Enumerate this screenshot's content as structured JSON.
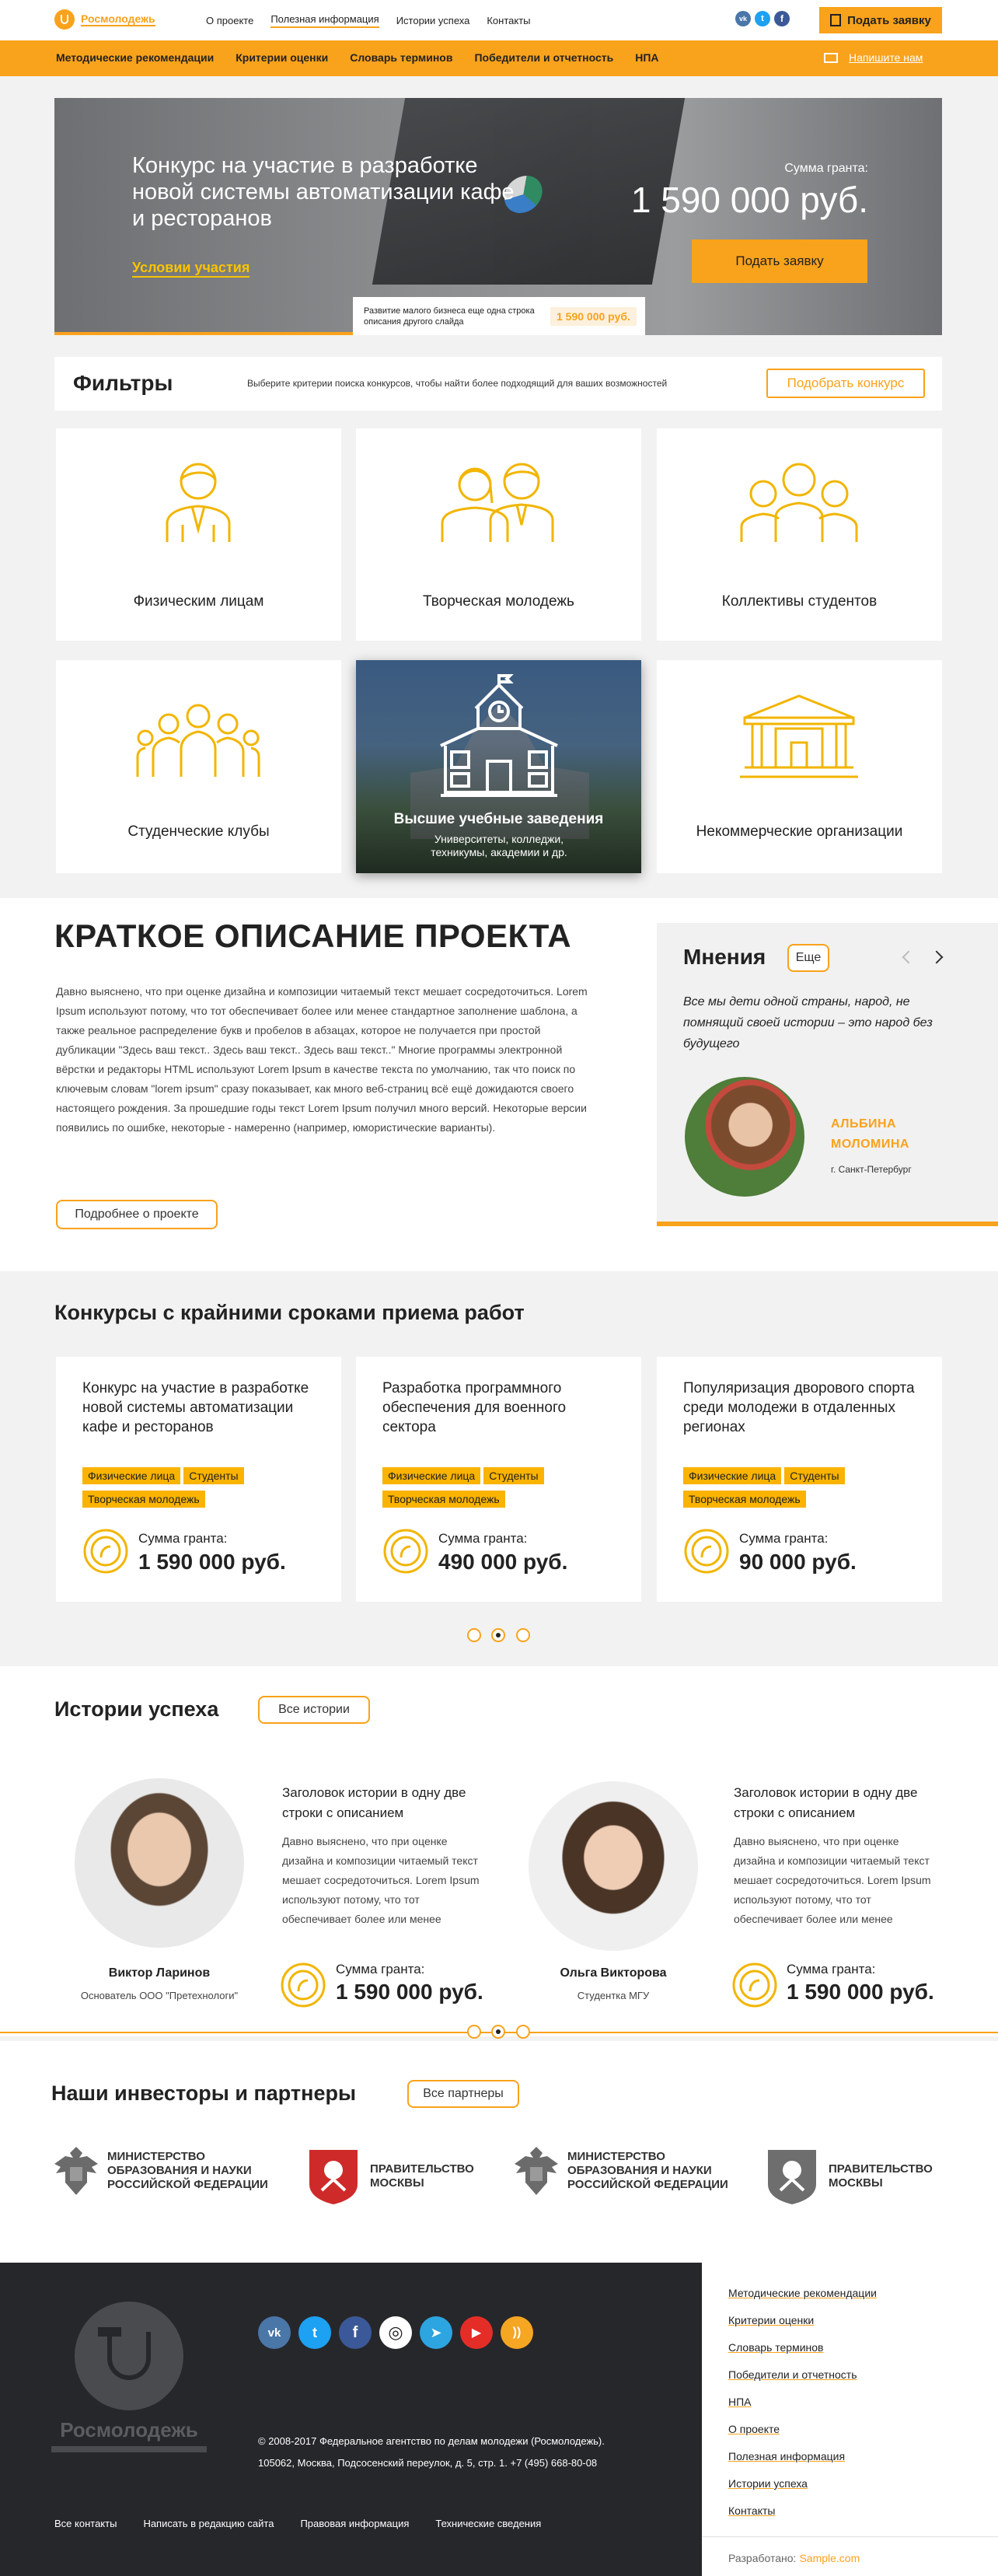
{
  "colors": {
    "accent": "#f9a21b",
    "accent_dark": "#f7a31a",
    "footer_bg": "#26272b",
    "icon": "#f2b500"
  },
  "header": {
    "logo_text": "Росмолодежь",
    "nav": [
      "О проекте",
      "Полезная информация",
      "Истории успеха",
      "Контакты"
    ],
    "social_icons": [
      "vk-icon",
      "twitter-icon",
      "facebook-icon"
    ],
    "apply_button": "Подать заявку"
  },
  "subnav": {
    "items": [
      "Методические рекомендации",
      "Критерии оценки",
      "Словарь терминов",
      "Победители и отчетность",
      "НПА"
    ],
    "write_us": "Напишите нам"
  },
  "hero": {
    "title": "Конкурс на участие в разработке новой системы автоматизации кафе и ресторанов",
    "conditions_link": "Условии участия",
    "grant_label": "Сумма гранта:",
    "grant_value": "1 590 000 руб.",
    "apply_button": "Подать заявку",
    "next_slide_text": "Развитие малого бизнеса еще одна строка описания другого слайда",
    "next_slide_amount": "1 590 000 руб."
  },
  "filters": {
    "title": "Фильтры",
    "description": "Выберите критерии поиска конкурсов, чтобы найти более подходящий для ваших возможностей",
    "button": "Подобрать конкурс",
    "categories": [
      {
        "label": "Физическим лицам",
        "icon": "person-icon"
      },
      {
        "label": "Творческая молодежь",
        "icon": "couple-icon"
      },
      {
        "label": "Коллективы студентов",
        "icon": "group-icon"
      },
      {
        "label": "Студенческие клубы",
        "icon": "club-icon"
      },
      {
        "label": "Высшие учебные заведения",
        "sub": "Университеты, колледжи, техникумы, академии и др.",
        "icon": "university-icon"
      },
      {
        "label": "Некоммерческие организации",
        "icon": "building-icon"
      }
    ]
  },
  "about": {
    "title": "КРАТКОЕ ОПИСАНИЕ ПРОЕКТА",
    "text": "Давно выяснено, что при оценке дизайна и композиции читаемый текст мешает сосредоточиться. Lorem Ipsum используют потому, что тот обеспечивает более или менее стандартное заполнение шаблона, а также реальное распределение букв и пробелов в абзацах, которое не получается при простой дубликации \"Здесь ваш текст.. Здесь ваш текст.. Здесь ваш текст..\" Многие программы электронной вёрстки и редакторы HTML используют Lorem Ipsum в качестве текста по умолчанию, так что поиск по ключевым словам \"lorem ipsum\" сразу показывает, как много веб-страниц всё ещё дожидаются своего настоящего рождения. За прошедшие годы текст Lorem Ipsum получил много версий. Некоторые версии появились по ошибке, некоторые - намеренно (например, юмористические варианты).",
    "more_button": "Подробнее о проекте"
  },
  "opinions": {
    "title": "Мнения",
    "more": "Еще",
    "quote": "Все мы дети одной страны, народ, не помнящий своей истории – это народ без будущего",
    "name": "АЛЬБИНА МОЛОМИНА",
    "city": "г. Санкт-Петербург"
  },
  "contests": {
    "title": "Конкурсы с крайними сроками приема работ",
    "grant_label": "Сумма гранта:",
    "items": [
      {
        "title": "Конкурс на участие в разработке новой системы автоматизации кафе и ресторанов",
        "tags": [
          "Физические лица",
          "Студенты",
          "Творческая молодежь"
        ],
        "amount": "1 590 000 руб."
      },
      {
        "title": "Разработка программного обеспечения для военного сектора",
        "tags": [
          "Физические лица",
          "Студенты",
          "Творческая молодежь"
        ],
        "amount": "490 000 руб."
      },
      {
        "title": "Популяризация дворового спорта среди молодежи в отдаленных регионах",
        "tags": [
          "Физические лица",
          "Студенты",
          "Творческая молодежь"
        ],
        "amount": "90 000 руб."
      }
    ]
  },
  "stories": {
    "title": "Истории успеха",
    "all_button": "Все истории",
    "grant_label": "Сумма гранта:",
    "items": [
      {
        "heading": "Заголовок истории в одну две строки с описанием",
        "text": "Давно выяснено, что при оценке дизайна и композиции читаемый текст мешает сосредоточиться. Lorem Ipsum используют потому, что тот обеспечивает более или менее",
        "name": "Виктор Ларинов",
        "role": "Основатель ООО \"Претехнологи\"",
        "amount": "1 590 000 руб."
      },
      {
        "heading": "Заголовок истории в одну две строки с описанием",
        "text": "Давно выяснено, что при оценке дизайна и композиции читаемый текст мешает сосредоточиться. Lorem Ipsum используют потому, что тот обеспечивает более или менее",
        "name": "Ольга Викторова",
        "role": "Студентка МГУ",
        "amount": "1 590 000 руб."
      }
    ]
  },
  "partners": {
    "title": "Наши инвесторы и партнеры",
    "all_button": "Все партнеры",
    "items": [
      {
        "name": "МИНИСТЕРСТВО ОБРАЗОВАНИЯ И НАУКИ РОССИЙСКОЙ ФЕДЕРАЦИИ",
        "icon": "eagle-emblem-icon"
      },
      {
        "name": "ПРАВИТЕЛЬСТВО МОСКВЫ",
        "icon": "moscow-emblem-icon"
      },
      {
        "name": "МИНИСТЕРСТВО ОБРАЗОВАНИЯ И НАУКИ РОССИЙСКОЙ ФЕДЕРАЦИИ",
        "icon": "eagle-emblem-icon"
      },
      {
        "name": "ПРАВИТЕЛЬСТВО МОСКВЫ",
        "icon": "moscow-emblem-icon"
      }
    ]
  },
  "footer": {
    "logo_text": "Росмолодежь",
    "social": [
      {
        "icon": "vk-icon",
        "color": "#4a76a8",
        "glyph": "vk"
      },
      {
        "icon": "twitter-icon",
        "color": "#1da1f2",
        "glyph": "t"
      },
      {
        "icon": "facebook-icon",
        "color": "#3b5998",
        "glyph": "f"
      },
      {
        "icon": "instagram-icon",
        "color": "#ffffff",
        "glyph": "◎"
      },
      {
        "icon": "telegram-icon",
        "color": "#2ca5e0",
        "glyph": "➤"
      },
      {
        "icon": "youtube-icon",
        "color": "#e52d27",
        "glyph": "▶"
      },
      {
        "icon": "rss-icon",
        "color": "#f5a623",
        "glyph": "))"
      }
    ],
    "copyright": "© 2008-2017 Федеральное агентство по делам молодежи (Росмолодежь).",
    "address": "105062, Москва, Подсосенский переулок, д. 5, стр. 1.  +7 (495) 668-80-08",
    "bottom_links": [
      "Все контакты",
      "Написать в редакцию сайта",
      "Правовая информация",
      "Технические сведения"
    ],
    "menu": [
      "Методические рекомендации",
      "Критерии оценки",
      "Словарь терминов",
      "Победители и отчетность",
      "НПА",
      "О проекте",
      "Полезная информация",
      "Истории успеха",
      "Контакты"
    ],
    "developed_label": "Разработано:",
    "developed_by": "Sample.com"
  }
}
